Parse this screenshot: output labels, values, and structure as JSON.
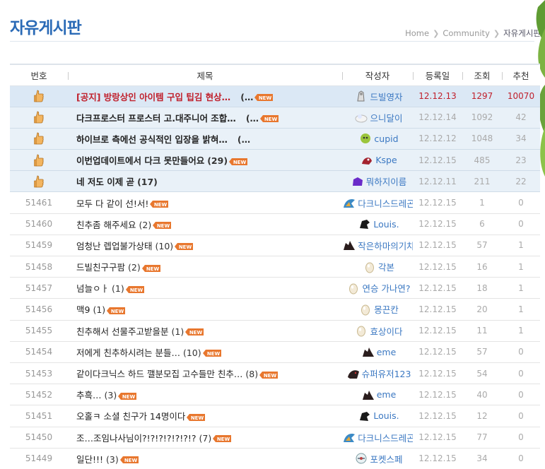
{
  "header": {
    "title": "자유게시판",
    "breadcrumb": [
      "Home",
      "Community",
      "자유게시판"
    ]
  },
  "columns": [
    "번호",
    "제목",
    "작성자",
    "등록일",
    "조회",
    "추천"
  ],
  "colors": {
    "accent": "#2a6ab6",
    "notice_red": "#c0202c",
    "author_blue": "#3b78c2",
    "new_orange": "#e8772e"
  },
  "notices": [
    {
      "title": "[공지] 방랑상인 아이템 구입 팁김 현상…",
      "comments": "(…",
      "author": "드빌영자",
      "avatar": "avatar-knight",
      "date": "12.12.13",
      "views": "1297",
      "rec": "10070"
    },
    {
      "title": "다크프로스터 프로스터 고.대주니어 조합…",
      "comments": "(…",
      "author": "으니달이",
      "avatar": "avatar-cloud",
      "date": "12.12.14",
      "views": "1092",
      "rec": "42"
    },
    {
      "title": "하이브로 측에선 공식적인 입장을 밝혀…",
      "comments": "(…",
      "author": "cupid",
      "avatar": "avatar-cupid",
      "date": "12.12.12",
      "views": "1048",
      "rec": "34"
    },
    {
      "title": "이번업데이트에서 다크 못만들어요",
      "comments": "(29)",
      "author": "Kspe",
      "avatar": "avatar-kspe",
      "date": "12.12.15",
      "views": "485",
      "rec": "23"
    },
    {
      "title": "네 저도 이제 곧",
      "comments": "(17)",
      "author": "뭐하지이름",
      "avatar": "avatar-purple",
      "date": "12.12.11",
      "views": "211",
      "rec": "22"
    }
  ],
  "posts": [
    {
      "num": "51461",
      "title": "모두 다 같이 선!서!",
      "comments": "",
      "author": "다크니스드레곤",
      "avatar": "avatar-dragon",
      "date": "12.12.15",
      "views": "1",
      "rec": "0"
    },
    {
      "num": "51460",
      "title": "친추좀 해주세요",
      "comments": "(2)",
      "author": "Louis.",
      "avatar": "avatar-black",
      "date": "12.12.15",
      "views": "6",
      "rec": "0"
    },
    {
      "num": "51459",
      "title": "엄청난 렙업불가상태",
      "comments": "(10)",
      "author": "작은하마의기차",
      "avatar": "avatar-dark",
      "date": "12.12.15",
      "views": "57",
      "rec": "1"
    },
    {
      "num": "51458",
      "title": "드빌친구구팜",
      "comments": "(2)",
      "author": "각본",
      "avatar": "avatar-egg",
      "date": "12.12.15",
      "views": "16",
      "rec": "1"
    },
    {
      "num": "51457",
      "title": "넘늘ㅇㅏ",
      "comments": "(1)",
      "author": "연승 가나연?",
      "avatar": "avatar-egg",
      "date": "12.12.15",
      "views": "18",
      "rec": "1"
    },
    {
      "num": "51456",
      "title": "맥9",
      "comments": "(1)",
      "author": "몽끈칸",
      "avatar": "avatar-egg",
      "date": "12.12.15",
      "views": "20",
      "rec": "1"
    },
    {
      "num": "51455",
      "title": "친추해서 선물주고받을분",
      "comments": "(1)",
      "author": "효상이다",
      "avatar": "avatar-egg",
      "date": "12.12.15",
      "views": "11",
      "rec": "1"
    },
    {
      "num": "51454",
      "title": "저에게 친추하시려는 분들…",
      "comments": "(10)",
      "author": "eme",
      "avatar": "avatar-dark",
      "date": "12.12.15",
      "views": "57",
      "rec": "0"
    },
    {
      "num": "51453",
      "title": "같이다크닉스 하드 깰분모집 고수들만 친추…",
      "comments": "(8)",
      "author": "슈퍼유저123",
      "avatar": "avatar-dark2",
      "date": "12.12.15",
      "views": "54",
      "rec": "0"
    },
    {
      "num": "51452",
      "title": "추흑…",
      "comments": "(3)",
      "author": "eme",
      "avatar": "avatar-dark",
      "date": "12.12.15",
      "views": "40",
      "rec": "0"
    },
    {
      "num": "51451",
      "title": "오홀ㅋ 소셜 친구가 14명이다",
      "comments": "",
      "author": "Louis.",
      "avatar": "avatar-black",
      "date": "12.12.15",
      "views": "12",
      "rec": "0"
    },
    {
      "num": "51450",
      "title": "조…조임나사님이?!?!?!?!?!?!?",
      "comments": "(7)",
      "author": "다크니스드레곤",
      "avatar": "avatar-dragon",
      "date": "12.12.15",
      "views": "77",
      "rec": "0"
    },
    {
      "num": "51449",
      "title": "일단!!!",
      "comments": "(3)",
      "author": "포켓스페",
      "avatar": "avatar-pocket",
      "date": "12.12.15",
      "views": "34",
      "rec": "0"
    }
  ]
}
